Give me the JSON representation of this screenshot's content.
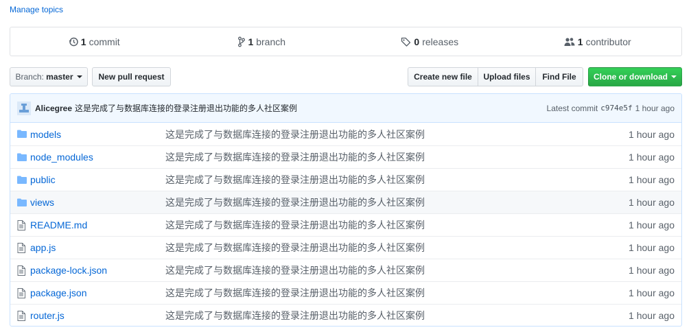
{
  "manage_topics": "Manage topics",
  "summary": {
    "commits": {
      "count": "1",
      "label": "commit"
    },
    "branches": {
      "count": "1",
      "label": "branch"
    },
    "releases": {
      "count": "0",
      "label": "releases"
    },
    "contributors": {
      "count": "1",
      "label": "contributor"
    }
  },
  "toolbar": {
    "branch_prefix": "Branch:",
    "branch_name": "master",
    "new_pull_request": "New pull request",
    "create_new_file": "Create new file",
    "upload_files": "Upload files",
    "find_file": "Find File",
    "clone_or_download": "Clone or download"
  },
  "latest_commit": {
    "author": "Alicegree",
    "message": "这是完成了与数据库连接的登录注册退出功能的多人社区案例",
    "label": "Latest commit",
    "sha": "c974e5f",
    "age": "1 hour ago"
  },
  "files": [
    {
      "type": "dir",
      "icon": "folder-icon",
      "name": "models",
      "message": "这是完成了与数据库连接的登录注册退出功能的多人社区案例",
      "age": "1 hour ago"
    },
    {
      "type": "dir",
      "icon": "folder-icon",
      "name": "node_modules",
      "message": "这是完成了与数据库连接的登录注册退出功能的多人社区案例",
      "age": "1 hour ago"
    },
    {
      "type": "dir",
      "icon": "folder-icon",
      "name": "public",
      "message": "这是完成了与数据库连接的登录注册退出功能的多人社区案例",
      "age": "1 hour ago"
    },
    {
      "type": "dir",
      "icon": "folder-icon",
      "name": "views",
      "message": "这是完成了与数据库连接的登录注册退出功能的多人社区案例",
      "age": "1 hour ago"
    },
    {
      "type": "file",
      "icon": "file-icon",
      "name": "README.md",
      "message": "这是完成了与数据库连接的登录注册退出功能的多人社区案例",
      "age": "1 hour ago"
    },
    {
      "type": "file",
      "icon": "file-icon",
      "name": "app.js",
      "message": "这是完成了与数据库连接的登录注册退出功能的多人社区案例",
      "age": "1 hour ago"
    },
    {
      "type": "file",
      "icon": "file-icon",
      "name": "package-lock.json",
      "message": "这是完成了与数据库连接的登录注册退出功能的多人社区案例",
      "age": "1 hour ago"
    },
    {
      "type": "file",
      "icon": "file-icon",
      "name": "package.json",
      "message": "这是完成了与数据库连接的登录注册退出功能的多人社区案例",
      "age": "1 hour ago"
    },
    {
      "type": "file",
      "icon": "file-icon",
      "name": "router.js",
      "message": "这是完成了与数据库连接的登录注册退出功能的多人社区案例",
      "age": "1 hour ago"
    }
  ],
  "colors": {
    "link": "#0366d6",
    "primary_button": "#28a745",
    "commit_tease_bg": "#f1f8ff",
    "folder_icon": "#79b8ff"
  }
}
